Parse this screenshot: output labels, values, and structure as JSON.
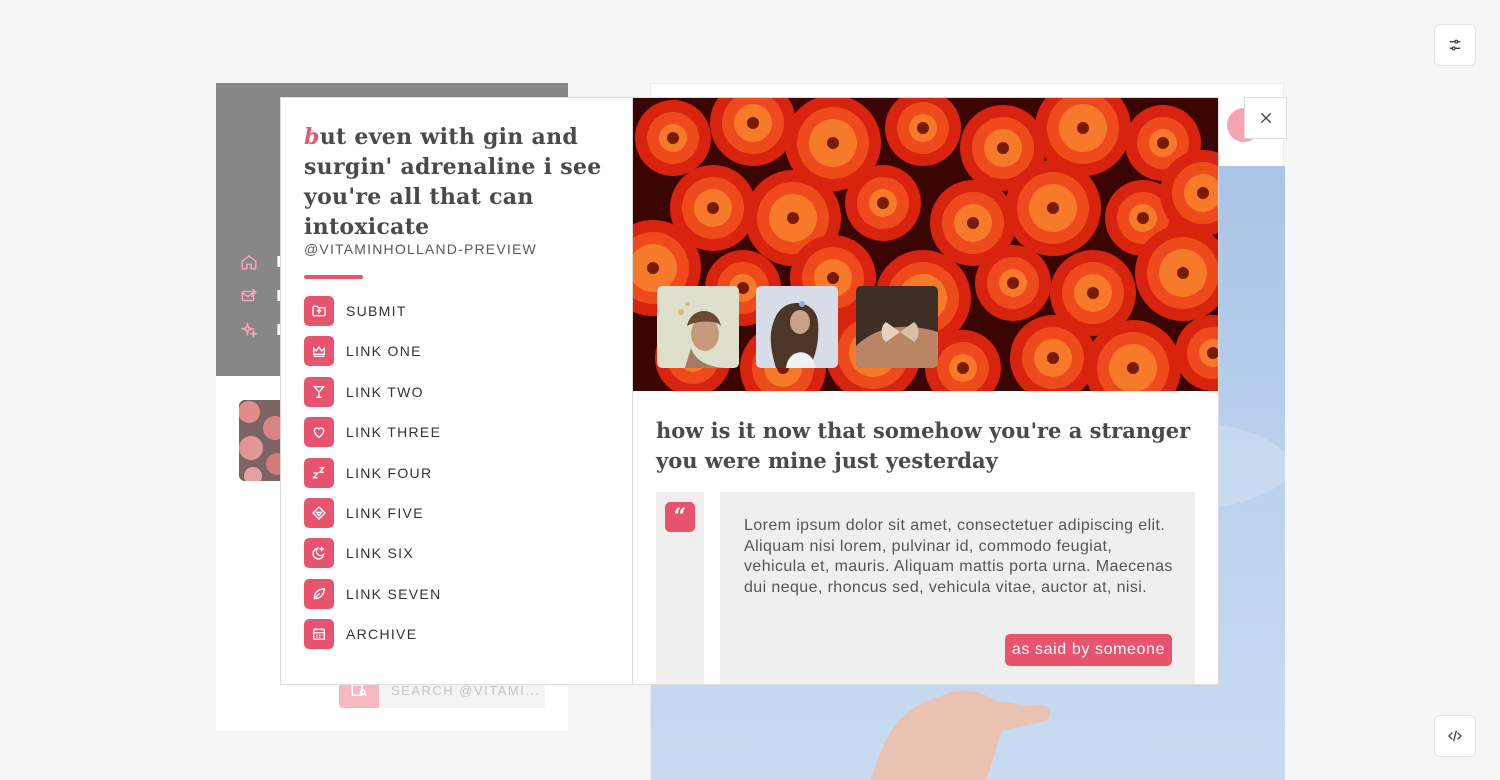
{
  "toolbar": {
    "settings_icon": "sliders-icon",
    "code_icon": "code-icon"
  },
  "background": {
    "nav": [
      {
        "label": "I",
        "icon": "home-icon"
      },
      {
        "label": "M",
        "icon": "mail-edit-icon"
      },
      {
        "label": "E",
        "icon": "sparkles-icon"
      }
    ],
    "search_placeholder": "SEARCH @VITAMI..."
  },
  "popup": {
    "title_dropcap": "b",
    "title_rest": "ut even with gin and surgin' adrenaline i see you're all that can intoxicate",
    "handle": "@VITAMINHOLLAND-PREVIEW",
    "accent_color": "#e8546e",
    "menu": [
      {
        "label": "SUBMIT",
        "icon": "folder-upload-icon"
      },
      {
        "label": "LINK ONE",
        "icon": "crown-icon"
      },
      {
        "label": "LINK TWO",
        "icon": "cocktail-icon"
      },
      {
        "label": "LINK THREE",
        "icon": "heart-icon"
      },
      {
        "label": "LINK FOUR",
        "icon": "sleep-zz-icon"
      },
      {
        "label": "LINK FIVE",
        "icon": "diamond-icon"
      },
      {
        "label": "LINK SIX",
        "icon": "moon-stars-icon"
      },
      {
        "label": "LINK SEVEN",
        "icon": "leaf-icon"
      },
      {
        "label": "ARCHIVE",
        "icon": "calendar-icon"
      }
    ],
    "quote_heading": "how is it now that somehow you're a stranger you were mine just yesterday",
    "quote_mark": "“",
    "quote_text": "Lorem ipsum dolor sit amet, consectetuer adipiscing elit. Aliquam nisi lorem, pulvinar id, commodo feugiat, vehicula et, mauris. Aliquam mattis porta urna. Maecenas dui neque, rhoncus sed, vehicula vitae, auctor at, nisi.",
    "quote_author": "as said by someone"
  }
}
